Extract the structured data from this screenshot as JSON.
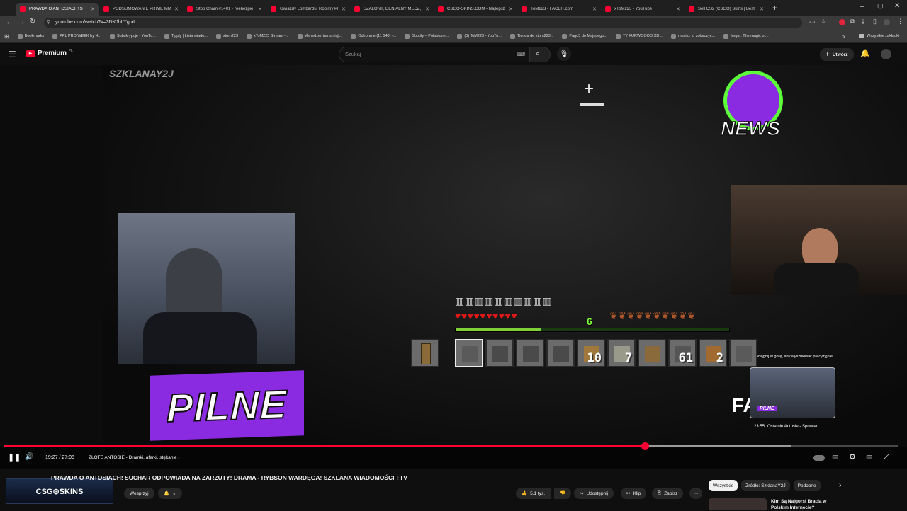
{
  "browser": {
    "tabs": [
      {
        "title": "PRAWDA O ANTOSIACH! S",
        "active": true
      },
      {
        "title": "PODSUMOWANIE PRIME MMA"
      },
      {
        "title": "Stop Cham #1401 - Niebezpie"
      },
      {
        "title": "Gwiazdy Lombardu: Robimy Pl"
      },
      {
        "title": "SZALONY, GENIALNY MECZ, G"
      },
      {
        "title": "CSGO-SKINS.COM - Najlepsze"
      },
      {
        "title": "ToM223 - FACEIT.com"
      },
      {
        "title": "xToM223 - YouTube"
      },
      {
        "title": "Sell CS2 (CSGO) Skins | Best C"
      }
    ],
    "new_tab": "+",
    "url": "youtube.com/watch?v=3NKJhLYgtxI",
    "bookmarks": [
      "Bookmarks",
      "PPL PRO WEEK by H...",
      "Subskrypcje - YouTu...",
      "Tipply | Lista wiado...",
      "xtom223",
      "xToM223 Stream -...",
      "Menedżer transmisji...",
      "Odebrane (11 548) -...",
      "Spotify – Polubione...",
      "(3) ToM223 - YouTu...",
      "Tienda de xtom223...",
      "Pago3 do Mającego...",
      "TY KURWOOOO XD...",
      "musisz to zobaczyć...",
      "Imgur: The magic of..."
    ],
    "bookmarks_more": "»",
    "all_bookmarks": "Wszystkie zakładki"
  },
  "youtube": {
    "logo": "Premium",
    "logo_sup": "PL",
    "search_placeholder": "Szukaj",
    "create_label": "Utwórz"
  },
  "video": {
    "watermark": "SZKLANAY2J",
    "news_badge": "NEWS",
    "pilne": "PILNE",
    "hotbar_counts": [
      "",
      "",
      "",
      "",
      "10",
      "7",
      "",
      "61",
      "2",
      ""
    ],
    "xp_level": "6",
    "xp_fraction": 0.31,
    "miniplayer_hint": "Pociągnij w górę, aby wyszukiwać precyzyjnie",
    "miniplayer_time": "23:55",
    "miniplayer_title": "Ostatnie Antosie - Spowied...",
    "miniplayer_badge": "PILNE",
    "overlay_fa": "FA"
  },
  "player": {
    "current_time": "19:27",
    "duration": "27:08",
    "time_sep": " / ",
    "chapter": "ZŁOTE ANTOSIE - Dramki, aferki, stękanie",
    "progress": 0.716,
    "buffered": 0.88
  },
  "details": {
    "title": "PRAWDA O ANTOSIACH! SUCHAR ODPOWIADA NA ZARZUTY! DRAMA - RYBSON WARDĘGA! SZKLANA WIADOMOŚCI TTV",
    "channel_banner": "CSG⊙SKINS",
    "support_label": "Wesprzyj",
    "likes": "5,1 tys.",
    "share_label": "Udostępnij",
    "clip_label": "Klip",
    "save_label": "Zapisz",
    "chips": [
      "Wszystkie",
      "Źródło: SzklanaY2J",
      "Podobne"
    ],
    "related_title_1": "Kim Są Najgorsi Bracia w",
    "related_title_2": "Polskim Internecie?"
  },
  "colors": {
    "accent": "#ff0033",
    "purple": "#8a2be2"
  }
}
